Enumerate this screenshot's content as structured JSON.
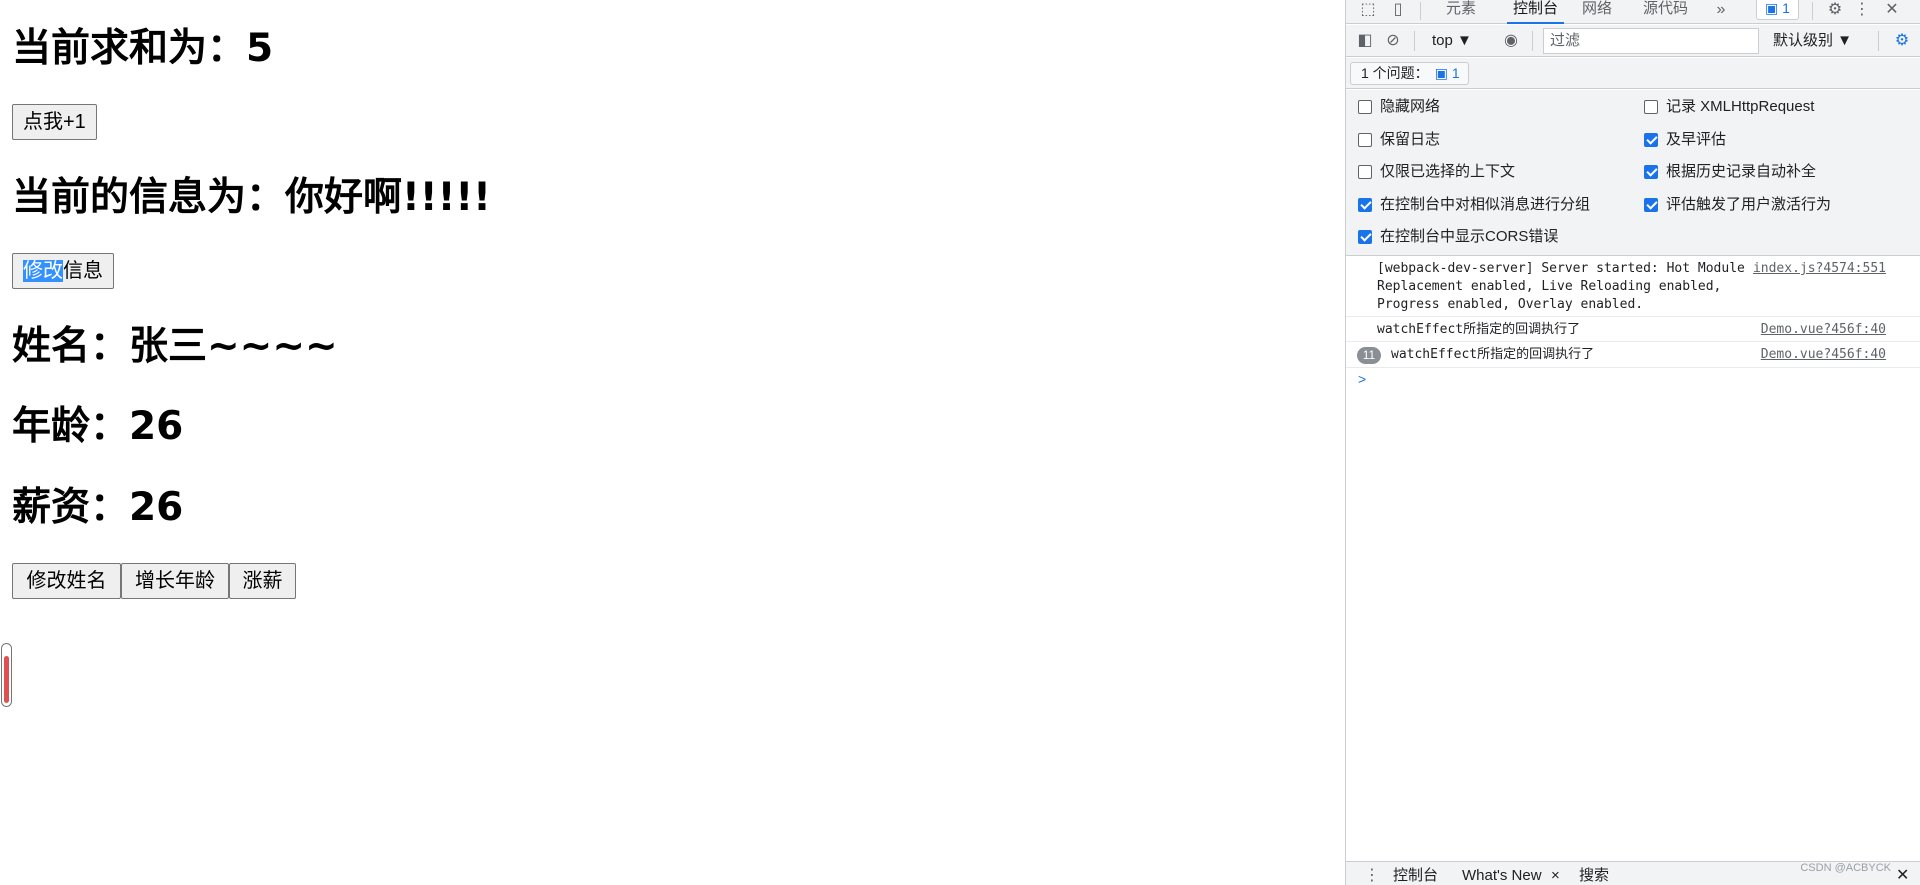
{
  "page": {
    "sum_heading": "当前求和为：5",
    "add_button": "点我+1",
    "msg_heading": "当前的信息为：你好啊!!!!!",
    "edit_msg_selected": "修改",
    "edit_msg_rest": "信息",
    "name_heading": "姓名：张三~~~~",
    "age_heading": "年龄：26",
    "salary_heading": "薪资：26",
    "edit_name_button": "修改姓名",
    "grow_age_button": "增长年龄",
    "raise_salary_button": "涨薪"
  },
  "devtools": {
    "tabs": [
      "元素",
      "控制台",
      "网络",
      "源代码"
    ],
    "more_tabs": "»",
    "issue_badge": "1",
    "context": "top ▼",
    "filter_placeholder": "过滤",
    "level": "默认级别 ▼",
    "issues_label": "1 个问题：",
    "issues_count": "1",
    "settings": {
      "left": [
        {
          "label": "隐藏网络",
          "checked": false
        },
        {
          "label": "保留日志",
          "checked": false
        },
        {
          "label": "仅限已选择的上下文",
          "checked": false
        },
        {
          "label": "在控制台中对相似消息进行分组",
          "checked": true
        },
        {
          "label": "在控制台中显示CORS错误",
          "checked": true
        }
      ],
      "right": [
        {
          "label": "记录 XMLHttpRequest",
          "checked": false
        },
        {
          "label": "及早评估",
          "checked": true
        },
        {
          "label": "根据历史记录自动补全",
          "checked": true
        },
        {
          "label": "评估触发了用户激活行为",
          "checked": true
        }
      ]
    },
    "logs": [
      {
        "message": "[webpack-dev-server] Server started: Hot Module Replacement enabled, Live Reloading enabled, Progress enabled, Overlay enabled.",
        "source": "index.js?4574:551"
      },
      {
        "message": "watchEffect所指定的回调执行了",
        "source": "Demo.vue?456f:40"
      },
      {
        "message": "watchEffect所指定的回调执行了",
        "source": "Demo.vue?456f:40",
        "repeat": "11"
      }
    ],
    "prompt": ">",
    "drawer_tabs": [
      "控制台",
      "What's New",
      "搜索"
    ],
    "drawer_close": "×",
    "watermark": "CSDN @ACBYCK"
  },
  "colors": {
    "accent": "#1a73e8",
    "selection": "#3390ff",
    "slider_fill": "#e05050"
  }
}
